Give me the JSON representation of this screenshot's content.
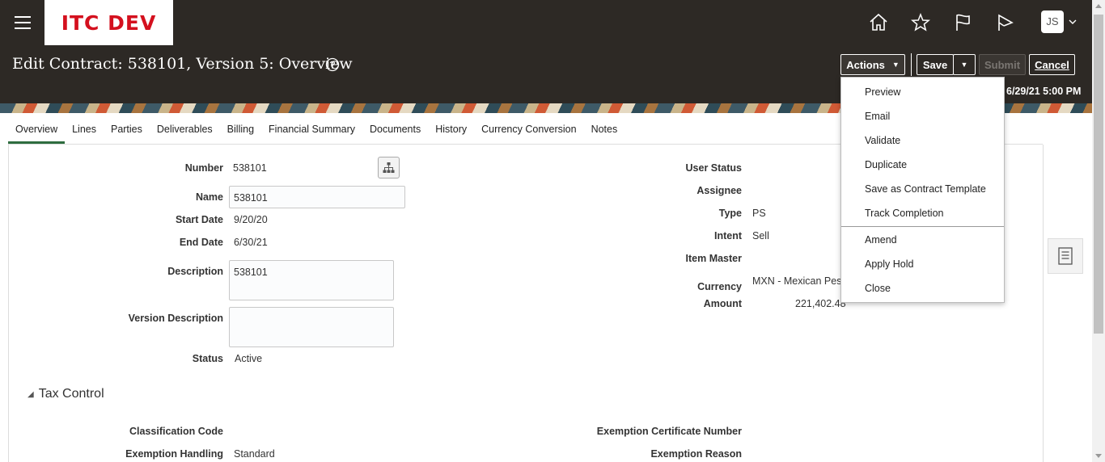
{
  "header": {
    "brand": "ITC DEV",
    "avatar_initials": "JS",
    "page_title": "Edit Contract: 538101, Version 5: Overview",
    "date_text": "6/29/21 5:00 PM",
    "icons": [
      "home-icon",
      "favorites-star-icon",
      "notifications-flag-icon",
      "watchlist-icon"
    ]
  },
  "toolbar": {
    "actions_label": "Actions",
    "save_label": "Save",
    "submit_label": "Submit",
    "cancel_label": "Cancel"
  },
  "actions_menu": {
    "items": [
      "Preview",
      "Email",
      "Validate",
      "Duplicate",
      "Save as Contract Template",
      "Track Completion",
      "Amend",
      "Apply Hold",
      "Close"
    ]
  },
  "tabs": [
    "Overview",
    "Lines",
    "Parties",
    "Deliverables",
    "Billing",
    "Financial Summary",
    "Documents",
    "History",
    "Currency Conversion",
    "Notes"
  ],
  "overview": {
    "left": {
      "number_label": "Number",
      "number_value": "538101",
      "name_label": "Name",
      "name_value": "538101",
      "start_label": "Start Date",
      "start_value": "9/20/20",
      "end_label": "End Date",
      "end_value": "6/30/21",
      "desc_label": "Description",
      "desc_value": "538101",
      "version_desc_label": "Version Description",
      "version_desc_value": "",
      "status_label": "Status",
      "status_value": "Active"
    },
    "right": {
      "user_status_label": "User Status",
      "assignee_label": "Assignee",
      "type_label": "Type",
      "type_value": "PS",
      "intent_label": "Intent",
      "intent_value": "Sell",
      "item_master_label": "Item Master",
      "currency_label": "Currency",
      "currency_value": "MXN - Mexican Peso",
      "amount_label": "Amount",
      "amount_value": "221,402.48"
    }
  },
  "tax_control": {
    "title": "Tax Control",
    "classification_label": "Classification Code",
    "exemption_handling_label": "Exemption Handling",
    "exemption_handling_value": "Standard",
    "exemption_cert_label": "Exemption Certificate Number",
    "exemption_reason_label": "Exemption Reason"
  },
  "colors": {
    "header_bg": "#2d2925",
    "brand_red": "#d4101e",
    "active_tab": "#2e6d3f"
  }
}
